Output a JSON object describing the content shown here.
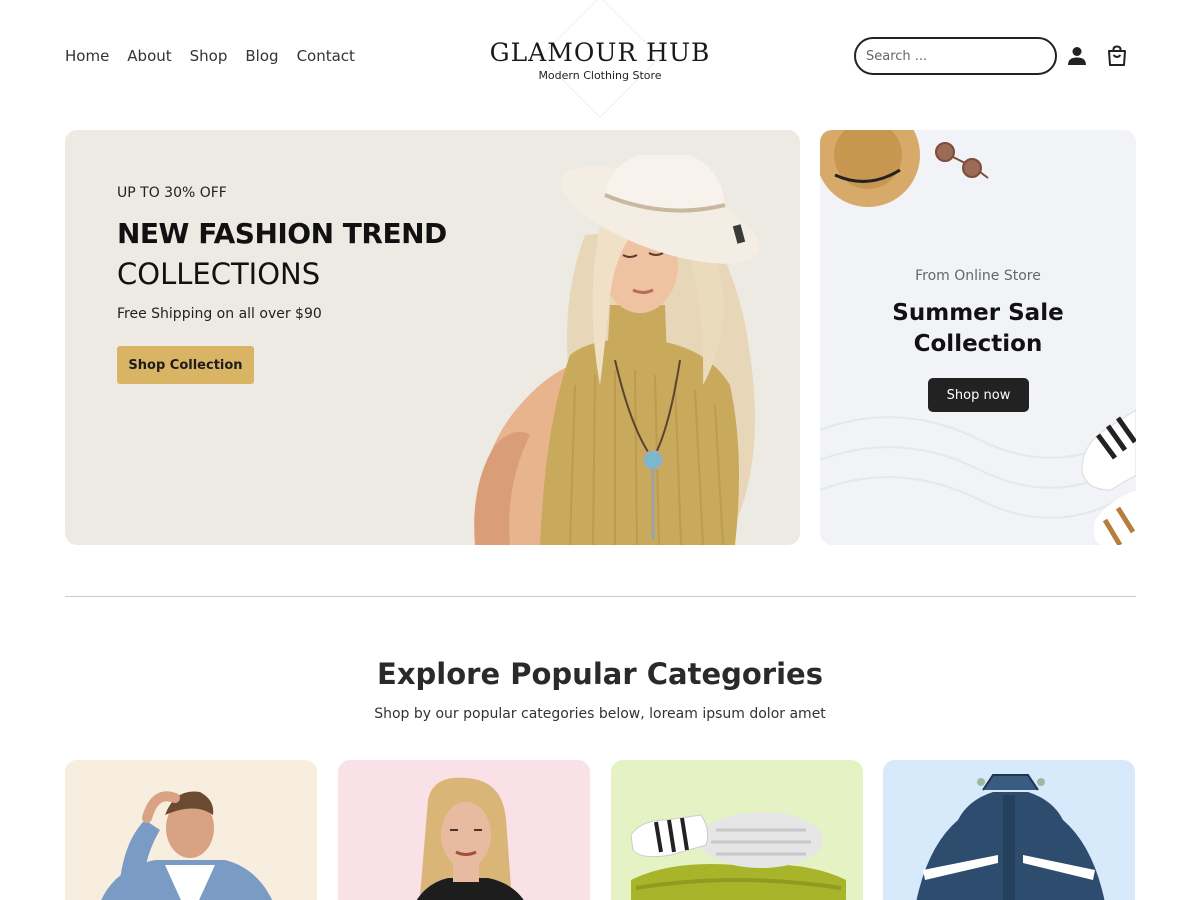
{
  "header": {
    "nav": [
      "Home",
      "About",
      "Shop",
      "Blog",
      "Contact"
    ],
    "logo_title": "GLAMOUR HUB",
    "logo_subtitle": "Modern Clothing Store",
    "search_placeholder": "Search ...",
    "icons": [
      "user-icon",
      "cart-icon"
    ]
  },
  "hero": {
    "kicker": "UP TO 30% OFF",
    "title_bold": "NEW FASHION TREND",
    "title_light": "COLLECTIONS",
    "note": "Free Shipping on all over $90",
    "button": "Shop Collection"
  },
  "promo": {
    "kicker": "From Online Store",
    "title_line1": "Summer Sale",
    "title_line2": "Collection",
    "button": "Shop now"
  },
  "categories": {
    "title": "Explore Popular Categories",
    "subtitle": "Shop by our popular categories below, loream ipsum dolor amet",
    "cards": [
      {
        "bg": "#f8eedf",
        "image": "man-denim-jacket"
      },
      {
        "bg": "#fae1e8",
        "image": "woman-portrait"
      },
      {
        "bg": "#e5f2c4",
        "image": "socks-and-knitwear"
      },
      {
        "bg": "#d7eafb",
        "image": "winter-jacket"
      }
    ]
  },
  "colors": {
    "accent": "#d9b465",
    "dark": "#222222",
    "hero_bg": "#ede9e3"
  }
}
